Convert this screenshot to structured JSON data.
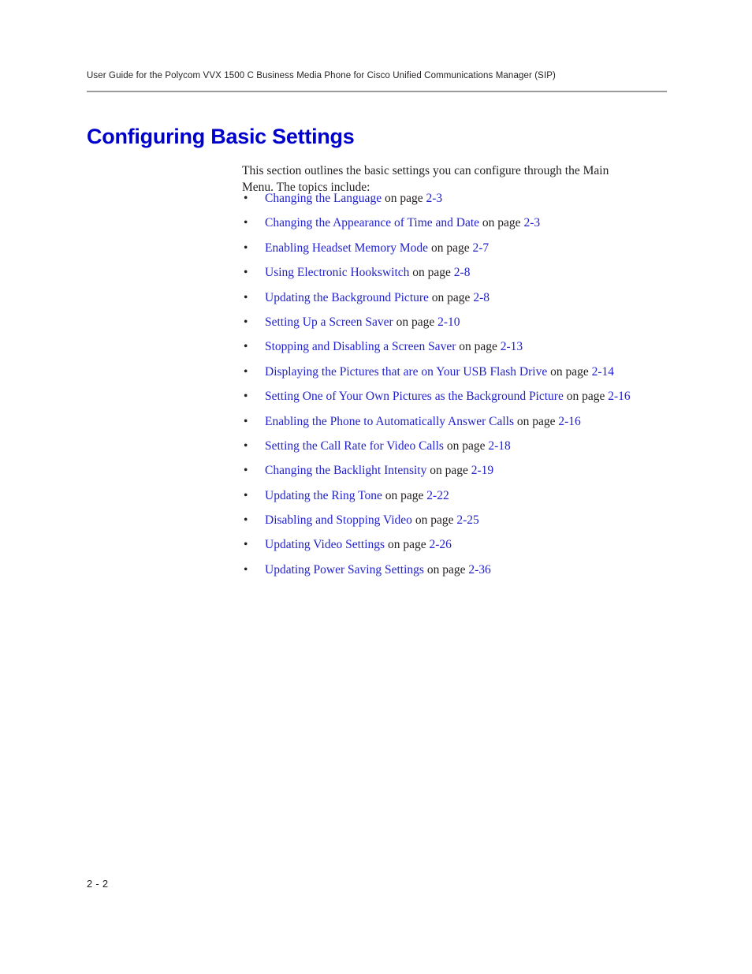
{
  "header": {
    "running_head": "User Guide for the Polycom VVX 1500 C Business Media Phone for Cisco Unified Communications Manager (SIP)"
  },
  "chapter": {
    "title": "Configuring Basic Settings"
  },
  "intro": {
    "text": "This section outlines the basic settings you can configure through the Main Menu. The topics include:"
  },
  "on_page_label": "on page",
  "bullet_char": "•",
  "topics": [
    {
      "title": "Changing the Language",
      "page": "2-3"
    },
    {
      "title": "Changing the Appearance of Time and Date",
      "page": "2-3"
    },
    {
      "title": "Enabling Headset Memory Mode",
      "page": "2-7"
    },
    {
      "title": "Using Electronic Hookswitch",
      "page": "2-8"
    },
    {
      "title": "Updating the Background Picture",
      "page": "2-8"
    },
    {
      "title": "Setting Up a Screen Saver",
      "page": "2-10"
    },
    {
      "title": "Stopping and Disabling a Screen Saver",
      "page": "2-13"
    },
    {
      "title": "Displaying the Pictures that are on Your USB Flash Drive",
      "page": "2-14"
    },
    {
      "title": "Setting One of Your Own Pictures as the Background Picture",
      "page": "2-16"
    },
    {
      "title": "Enabling the Phone to Automatically Answer Calls",
      "page": "2-16"
    },
    {
      "title": "Setting the Call Rate for Video Calls",
      "page": "2-18"
    },
    {
      "title": "Changing the Backlight Intensity",
      "page": "2-19"
    },
    {
      "title": "Updating the Ring Tone",
      "page": "2-22"
    },
    {
      "title": "Disabling and Stopping Video",
      "page": "2-25"
    },
    {
      "title": "Updating Video Settings",
      "page": "2-26"
    },
    {
      "title": "Updating Power Saving Settings",
      "page": "2-36"
    }
  ],
  "footer": {
    "page_number": "2 - 2"
  },
  "colors": {
    "link": "#2222cc",
    "title": "#0000cc",
    "text": "#231f20",
    "rule": "#9a9a9a"
  }
}
